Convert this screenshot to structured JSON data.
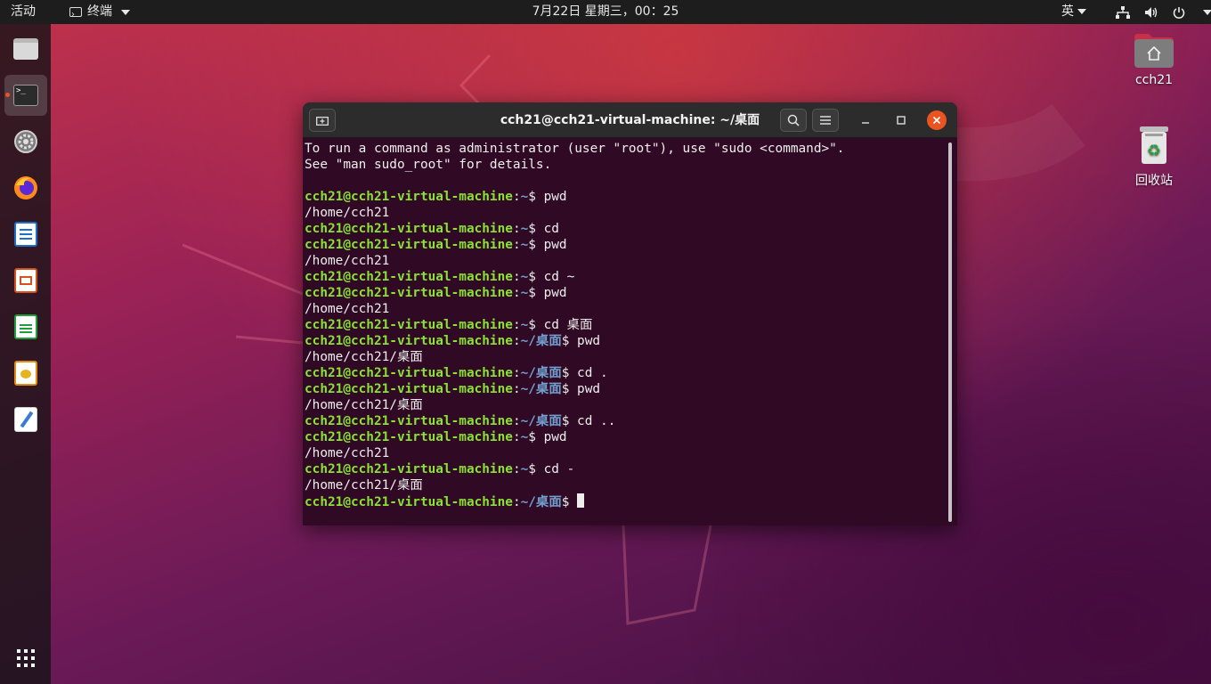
{
  "topbar": {
    "activities": "活动",
    "app_menu": "终端",
    "clock": "7月22日 星期三，00：25",
    "input_method": "英",
    "tray_icons": [
      "network-icon",
      "volume-icon",
      "power-icon"
    ]
  },
  "dock": {
    "items": [
      "files",
      "terminal",
      "settings",
      "firefox",
      "writer",
      "impress",
      "calc",
      "draw",
      "text-editor"
    ],
    "active": "terminal",
    "apps_grid_icon": "grid-icon"
  },
  "desktop": {
    "home_label": "cch21",
    "trash_label": "回收站"
  },
  "terminal": {
    "title": "cch21@cch21-virtual-machine: ~/桌面",
    "lines": [
      {
        "out": "To run a command as administrator (user \"root\"), use \"sudo <command>\"."
      },
      {
        "out": "See \"man sudo_root\" for details."
      },
      {
        "out": ""
      },
      {
        "user": "cch21@cch21-virtual-machine",
        "path": "~",
        "cmd": "pwd"
      },
      {
        "out": "/home/cch21"
      },
      {
        "user": "cch21@cch21-virtual-machine",
        "path": "~",
        "cmd": "cd"
      },
      {
        "user": "cch21@cch21-virtual-machine",
        "path": "~",
        "cmd": "pwd"
      },
      {
        "out": "/home/cch21"
      },
      {
        "user": "cch21@cch21-virtual-machine",
        "path": "~",
        "cmd": "cd ~"
      },
      {
        "user": "cch21@cch21-virtual-machine",
        "path": "~",
        "cmd": "pwd"
      },
      {
        "out": "/home/cch21"
      },
      {
        "user": "cch21@cch21-virtual-machine",
        "path": "~",
        "cmd": "cd 桌面"
      },
      {
        "user": "cch21@cch21-virtual-machine",
        "path": "~/桌面",
        "cmd": "pwd"
      },
      {
        "out": "/home/cch21/桌面"
      },
      {
        "user": "cch21@cch21-virtual-machine",
        "path": "~/桌面",
        "cmd": "cd ."
      },
      {
        "user": "cch21@cch21-virtual-machine",
        "path": "~/桌面",
        "cmd": "pwd"
      },
      {
        "out": "/home/cch21/桌面"
      },
      {
        "user": "cch21@cch21-virtual-machine",
        "path": "~/桌面",
        "cmd": "cd .."
      },
      {
        "user": "cch21@cch21-virtual-machine",
        "path": "~",
        "cmd": "pwd"
      },
      {
        "out": "/home/cch21"
      },
      {
        "user": "cch21@cch21-virtual-machine",
        "path": "~",
        "cmd": "cd -"
      },
      {
        "out": "/home/cch21/桌面"
      },
      {
        "user": "cch21@cch21-virtual-machine",
        "path": "~/桌面",
        "cmd": "",
        "cursor": true
      }
    ]
  },
  "colors": {
    "terminal_bg": "#300a24",
    "prompt_user": "#8ae234",
    "prompt_path": "#729fcf",
    "accent": "#e95420"
  }
}
